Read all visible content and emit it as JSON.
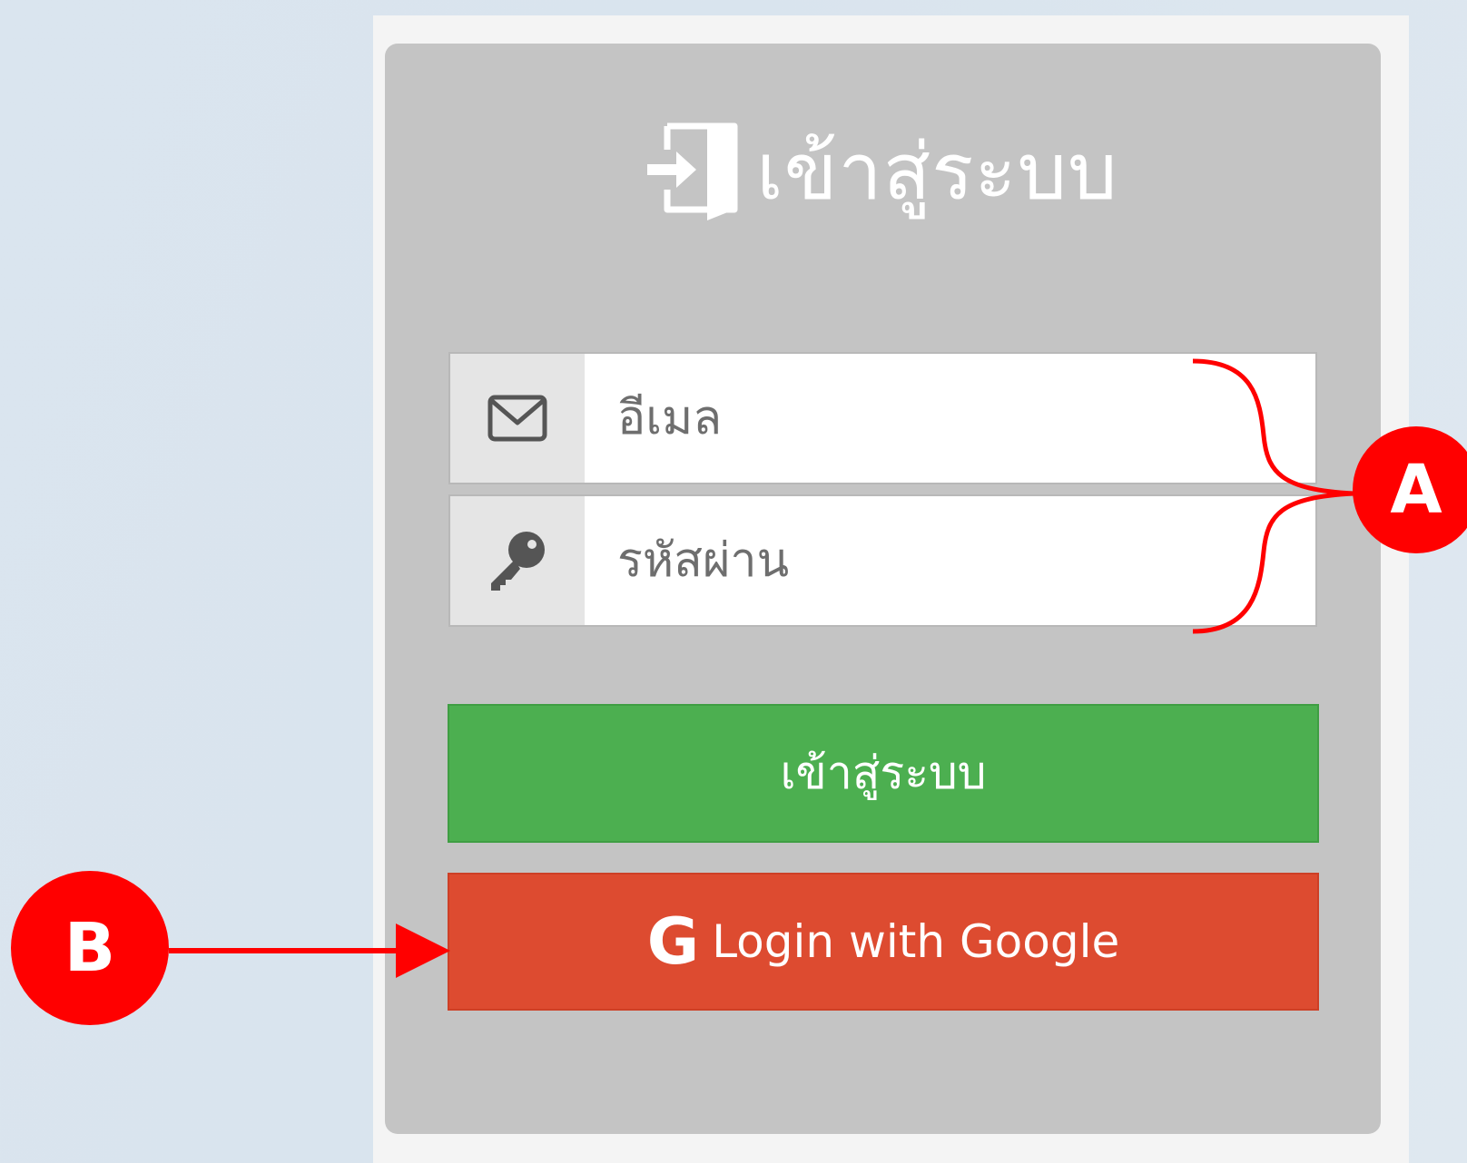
{
  "login_card": {
    "title": "เข้าสู่ระบบ",
    "title_icon": "sign-in-door-icon"
  },
  "email_field": {
    "icon": "envelope-icon",
    "placeholder": "อีเมล",
    "value": ""
  },
  "password_field": {
    "icon": "key-icon",
    "placeholder": "รหัสผ่าน",
    "value": ""
  },
  "login_button": {
    "label": "เข้าสู่ระบบ",
    "color": "#4caf50"
  },
  "google_button": {
    "icon": "google-g-icon",
    "icon_text": "G",
    "label": "Login with Google",
    "color": "#dd4b30"
  },
  "annotations": {
    "callout_a": "A",
    "callout_b": "B",
    "color": "#ff0000"
  }
}
